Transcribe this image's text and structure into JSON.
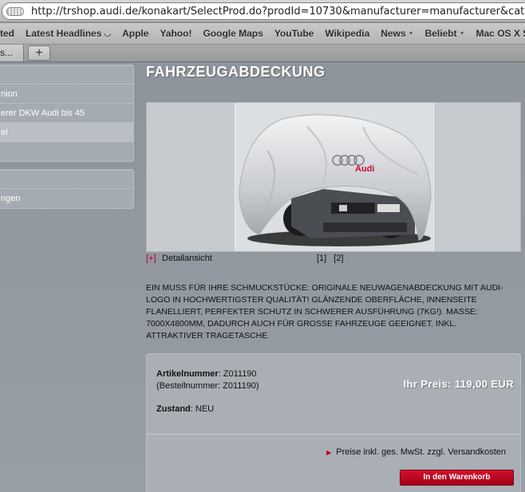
{
  "browser": {
    "url": "http://trshop.audi.de/konakart/SelectProd.do?prodId=10730&manufacturer=manufacturer&category=Akt",
    "bookmarks": [
      {
        "label": "ted",
        "icon": ""
      },
      {
        "label": "Latest Headlines",
        "icon": "rss-icon"
      },
      {
        "label": "Apple",
        "icon": ""
      },
      {
        "label": "Yahoo!",
        "icon": ""
      },
      {
        "label": "Google Maps",
        "icon": ""
      },
      {
        "label": "YouTube",
        "icon": ""
      },
      {
        "label": "Wikipedia",
        "icon": ""
      },
      {
        "label": "News",
        "icon": "chevron-down-icon"
      },
      {
        "label": "Beliebt",
        "icon": "chevron-down-icon"
      },
      {
        "label": "Mac OS X So",
        "icon": ""
      }
    ],
    "tab_label": "s...",
    "new_tab_label": "+"
  },
  "sidebar": {
    "group1": [
      "",
      "nion",
      "erer DKW Audi bis 45",
      "el",
      ""
    ],
    "group2": [
      "",
      "ngen"
    ]
  },
  "product": {
    "title": "FAHRZEUGABDECKUNG",
    "image_logo_text": "Audi",
    "detail_plus": "[+]",
    "detail_label": "Detailansicht",
    "page_links": [
      "[1]",
      "[2]"
    ],
    "description": "EIN MUSS FÜR IHRE SCHMUCKSTÜCKE: ORIGINALE NEUWAGENABDECKUNG MIT AUDI-LOGO IN HOCHWERTIGSTER QUALITÄT! GLÄNZENDE OBERFLÄCHE, INNENSEITE FLANELLIERT, PERFEKTER SCHUTZ IN SCHWERER AUSFÜHRUNG (7Kg!). MAßE: 7000x4800MM, DADURCH AUCH FÜR GROßE FAHRZEUGE GEEIGNET. INKL. ATTRAKTIVER TRAGETASCHE",
    "article_label": "Artikelnummer",
    "article_value": ": Z011190",
    "order_number": "(Bestellnummer: Z011190)",
    "condition_label": "Zustand",
    "condition_value": ": NEU",
    "price": "Ihr Preis: 119,00 EUR",
    "price_note": "Preise inkl. ges. MwSt. zzgl. Versandkosten",
    "cart_button": "In den Warenkorb"
  },
  "colors": {
    "accent_red": "#c0001f",
    "panel": "#a9afb5"
  }
}
